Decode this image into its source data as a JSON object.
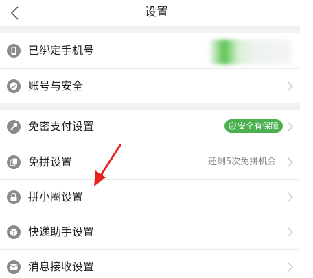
{
  "header": {
    "title": "设置",
    "back_icon": "chevron-left-icon"
  },
  "colors": {
    "accent_green": "#4caf50",
    "icon_gray": "#8a8a8a",
    "arrow_red": "#e8211c",
    "section_gap": "#f2f2f2"
  },
  "items": [
    {
      "label": "已绑定手机号",
      "icon": "phone-icon"
    },
    {
      "label": "账号与安全",
      "icon": "shield-check-icon"
    },
    {
      "label": "免密支付设置",
      "icon": "key-icon",
      "badge": "安全有保障"
    },
    {
      "label": "免拼设置",
      "icon": "copy-icon",
      "hint": "还剩5次免拼机会"
    },
    {
      "label": "拼小圈设置",
      "icon": "lock-icon"
    },
    {
      "label": "快递助手设置",
      "icon": "package-icon"
    },
    {
      "label": "消息接收设置",
      "icon": "message-icon"
    }
  ]
}
